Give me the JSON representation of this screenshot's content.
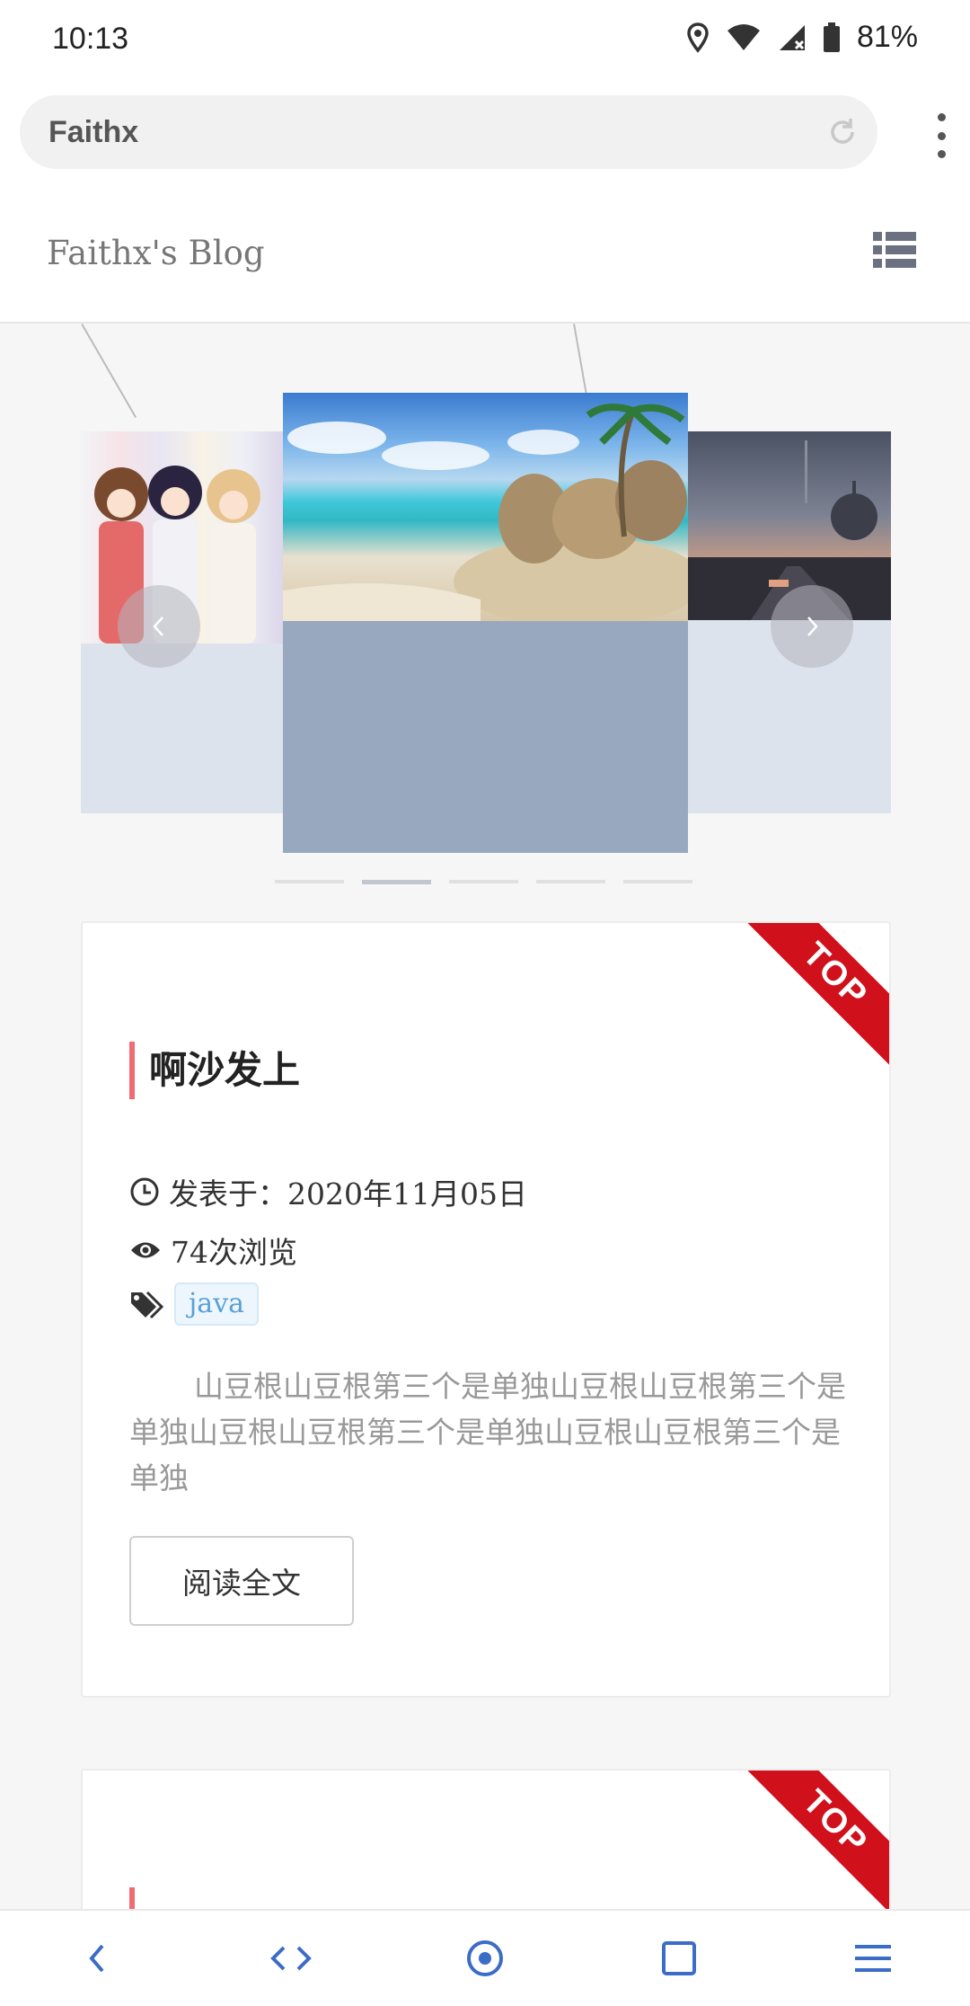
{
  "status_bar": {
    "time": "10:13",
    "battery": "81%",
    "icons": [
      "location-icon",
      "wifi-icon",
      "signal-icon",
      "battery-icon"
    ]
  },
  "browser": {
    "url": "Faithx",
    "icons": [
      "reload-icon",
      "overflow-menu-icon"
    ]
  },
  "site": {
    "title": "Faithx's Blog",
    "menu_icon": "list-menu-icon"
  },
  "carousel": {
    "slide_count": 5,
    "active_index": 1,
    "slides": [
      "anime-girls-image",
      "tropical-beach-image",
      "futuristic-road-image"
    ]
  },
  "posts": [
    {
      "badge": "TOP",
      "title": "啊沙发上",
      "date": "发表于：2020年11月05日",
      "views": "74次浏览",
      "tags": [
        "java"
      ],
      "excerpt": "山豆根山豆根第三个是单独山豆根山豆根第三个是单独山豆根山豆根第三个是单独山豆根山豆根第三个是单独",
      "read_more": "阅读全文"
    },
    {
      "badge": "TOP"
    }
  ],
  "bottom_nav": [
    "back-icon",
    "code-icon",
    "home-target-icon",
    "tabs-square-icon",
    "menu-lines-icon"
  ],
  "colors": {
    "accent_red": "#d0101b",
    "title_bar": "#f06b73",
    "tag_blue": "#5aa0d6",
    "nav_blue": "#3a6cc8"
  }
}
